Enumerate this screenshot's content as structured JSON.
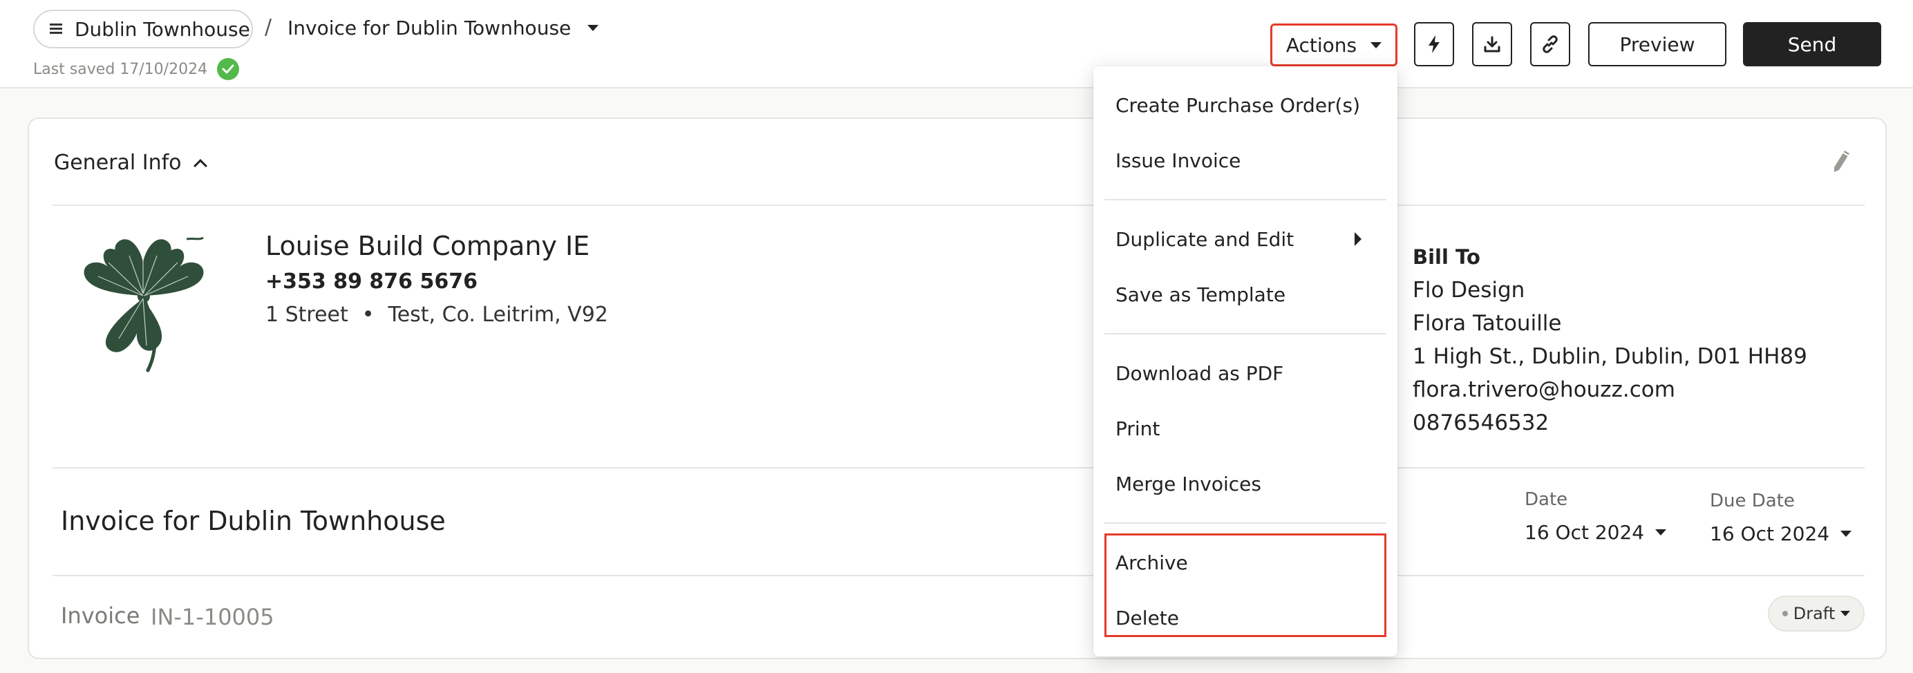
{
  "header": {
    "project_name": "Dublin Townhouse",
    "separator": "/",
    "doc_title": "Invoice for Dublin Townhouse",
    "last_saved": "Last saved 17/10/2024",
    "actions_label": "Actions",
    "preview_label": "Preview",
    "send_label": "Send",
    "icons": [
      "lightning-icon",
      "download-icon",
      "link-icon"
    ]
  },
  "section": {
    "title": "General Info"
  },
  "company": {
    "name": "Louise Build Company IE",
    "phone": "+353 89 876 5676",
    "street": "1 Street",
    "bullet": "•",
    "city": "Test, Co. Leitrim, V92"
  },
  "bill_to": {
    "heading": "Bill To",
    "name": "Flo Design",
    "contact": "Flora Tatouille",
    "address": "1 High St., Dublin, Dublin, D01 HH89",
    "email": "flora.trivero@houzz.com",
    "phone": "0876546532"
  },
  "invoice": {
    "heading": "Invoice for Dublin Townhouse",
    "date_label": "Date",
    "date_value": "16 Oct 2024",
    "due_label": "Due Date",
    "due_value": "16 Oct 2024",
    "type_label": "Invoice",
    "number": "IN-1-10005",
    "status": "Draft"
  },
  "menu": {
    "items": [
      "Create Purchase Order(s)",
      "Issue Invoice",
      "Duplicate and Edit",
      "Save as Template",
      "Download as PDF",
      "Print",
      "Merge Invoices",
      "Archive",
      "Delete"
    ]
  },
  "colors": {
    "highlight": "#e53a2a",
    "check": "#52b94a",
    "send_bg": "#222222",
    "logo_green": "#2f4f3a"
  }
}
